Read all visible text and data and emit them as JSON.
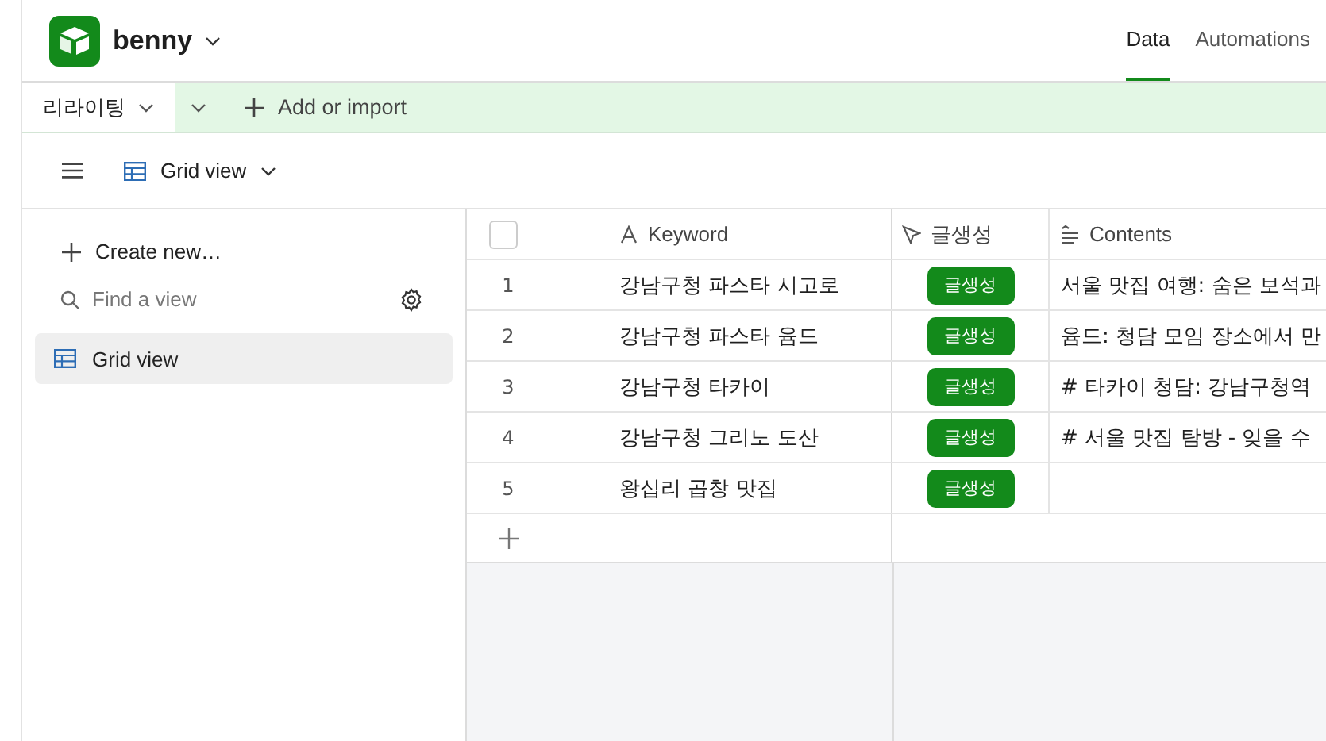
{
  "base": {
    "name": "benny"
  },
  "nav_tabs": [
    {
      "label": "Data",
      "selected": true
    },
    {
      "label": "Automations",
      "selected": false
    }
  ],
  "table_tabs": [
    {
      "label": "리라이팅",
      "selected": true
    }
  ],
  "add_button": "Add or import",
  "view_bar": {
    "current_view": "Grid view"
  },
  "sidebar": {
    "create": "Create new…",
    "search": {
      "placeholder": "Find a view"
    },
    "views": [
      {
        "label": "Grid view",
        "selected": true
      }
    ]
  },
  "table": {
    "select_all": {
      "checked": false
    },
    "columns": [
      {
        "label": "Keyword",
        "kind": "text"
      },
      {
        "label": "글생성",
        "kind": "button"
      },
      {
        "label": "Contents",
        "kind": "longtext"
      }
    ],
    "rows": [
      {
        "number": "1",
        "keyword": "강남구청 파스타 시고로",
        "action": "글생성",
        "contents": "서울 맛집 여행: 숨은 보석과"
      },
      {
        "number": "2",
        "keyword": "강남구청 파스타 윰드",
        "action": "글생성",
        "contents": "윰드: 청담 모임 장소에서 만"
      },
      {
        "number": "3",
        "keyword": "강남구청 타카이",
        "action": "글생성",
        "contents": "# 타카이 청담: 강남구청역"
      },
      {
        "number": "4",
        "keyword": "강남구청 그리노 도산",
        "action": "글생성",
        "contents": "# 서울 맛집 탐방 - 잊을 수"
      },
      {
        "number": "5",
        "keyword": "왕십리 곱창 맛집",
        "action": "글생성",
        "contents": ""
      }
    ]
  }
}
